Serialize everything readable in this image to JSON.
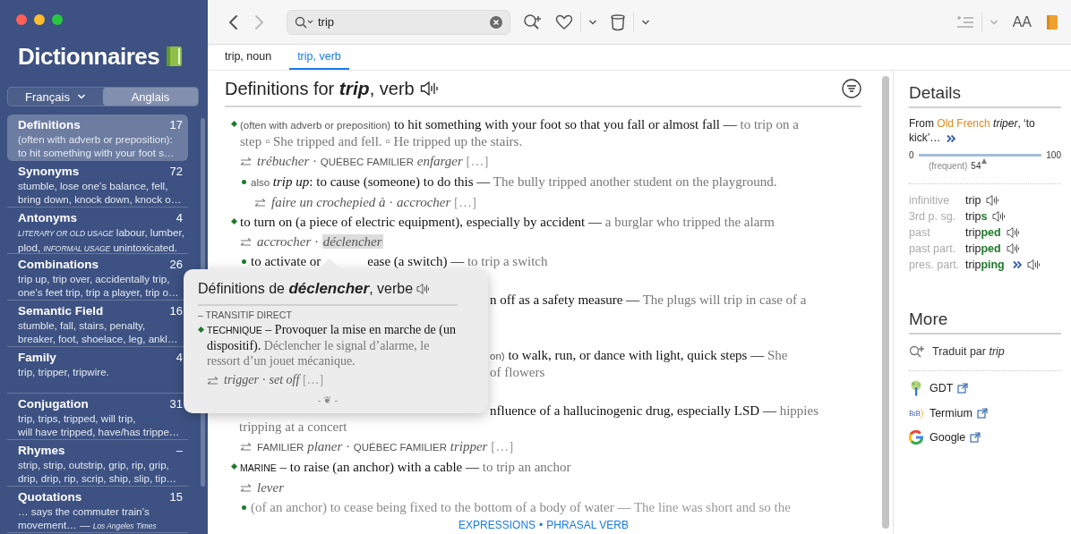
{
  "sidebar": {
    "title": "Dictionnaires",
    "languages": [
      {
        "label": "Français",
        "dropdown": true,
        "selected": false
      },
      {
        "label": "Anglais",
        "dropdown": false,
        "selected": true
      }
    ],
    "items": [
      {
        "title": "Definitions",
        "count": "17",
        "selected": true,
        "lines": [
          "(often with adverb or preposition):",
          "to hit something with your foot s…"
        ]
      },
      {
        "title": "Synonyms",
        "count": "72",
        "selected": false,
        "lines": [
          "stumble, lose one’s balance, fell,",
          "bring down, knock down, knock o…"
        ]
      },
      {
        "title": "Antonyms",
        "count": "4",
        "selected": false,
        "lines": [
          "*LITERARY OR OLD USAGE* labour, lumber,",
          "plod, *INFORMAL USAGE* unintoxicated."
        ]
      },
      {
        "title": "Combinations",
        "count": "26",
        "selected": false,
        "lines": [
          "trip up, trip over, accidentally trip,",
          "one’s feet trip, trip a player, trip o…"
        ]
      },
      {
        "title": "Semantic Field",
        "count": "16",
        "selected": false,
        "lines": [
          "stumble, fall, stairs, penalty,",
          "breaker, foot, shoelace, leg, ankl…"
        ]
      },
      {
        "title": "Family",
        "count": "4",
        "selected": false,
        "lines": [
          "trip, tripper, tripwire."
        ]
      },
      {
        "title": "Conjugation",
        "count": "31",
        "selected": false,
        "lines": [
          "trip, trips, tripped, will trip,",
          "will have tripped, have/has trippe…"
        ]
      },
      {
        "title": "Rhymes",
        "count": "–",
        "selected": false,
        "lines": [
          "strip, strip, outstrip, grip, rip, grip,",
          "drip, drip, rip, scrip, ship, slip, tip…"
        ]
      },
      {
        "title": "Quotations",
        "count": "15",
        "selected": false,
        "lines": [
          "… says the commuter train’s",
          "movement…  — *Los Angeles Times*"
        ]
      }
    ]
  },
  "toolbar": {
    "back_enabled": true,
    "forward_enabled": false,
    "search": {
      "value": "trip"
    },
    "font_size_label": "AA"
  },
  "tabs": [
    {
      "label": "trip, noun",
      "selected": false
    },
    {
      "label": "trip, verb",
      "selected": true
    }
  ],
  "entry": {
    "heading": {
      "prefix": "Definitions for",
      "word": "trip",
      "suffix": ", verb"
    },
    "lines": [
      {
        "kind": "sense",
        "parts": [
          {
            "kind": "label",
            "text": "(often with adverb or preposition)"
          },
          {
            "kind": "def",
            "text": "to hit something with your foot so that you fall or almost fall —"
          },
          {
            "kind": "example",
            "text": "to trip on a step ▫ She tripped and fell. ▫ He tripped up the stairs."
          }
        ]
      },
      {
        "kind": "translation",
        "parts": [
          {
            "kind": "word",
            "text": "trébucher"
          },
          {
            "kind": "sep",
            "text": "·"
          },
          {
            "kind": "label",
            "text": "QUÉBEC FAMILIER"
          },
          {
            "kind": "word",
            "text": "enfarger"
          },
          {
            "kind": "note",
            "text": "[…]"
          }
        ]
      },
      {
        "kind": "subsense",
        "parts": [
          {
            "kind": "label",
            "text": "also"
          },
          {
            "kind": "def",
            "text": "*trip up*: to cause (someone) to do this —"
          },
          {
            "kind": "example",
            "text": "The bully tripped another student on the playground."
          }
        ]
      },
      {
        "kind": "subtranslation",
        "parts": [
          {
            "kind": "word",
            "text": "faire un crochepied à"
          },
          {
            "kind": "sep",
            "text": "·"
          },
          {
            "kind": "word",
            "text": "accrocher"
          },
          {
            "kind": "note",
            "text": "[…]"
          }
        ]
      },
      {
        "kind": "sense",
        "parts": [
          {
            "kind": "def",
            "text": "to turn on (a piece of electric equipment), especially by accident —"
          },
          {
            "kind": "example",
            "text": "a burglar who tripped the alarm"
          }
        ]
      },
      {
        "kind": "translation",
        "parts": [
          {
            "kind": "word",
            "text": "accrocher",
            "highlighted": false
          },
          {
            "kind": "sep",
            "text": "·"
          },
          {
            "kind": "word",
            "text": "déclencher",
            "highlighted": true
          }
        ]
      },
      {
        "kind": "split",
        "parts": [
          {
            "kind": "def",
            "text": "to activate or"
          }
        ],
        "right_parts": [
          {
            "kind": "def",
            "text": "ease (a switch) —"
          },
          {
            "kind": "example",
            "text": "to trip a switch"
          }
        ]
      },
      {
        "kind": "partial",
        "parts": [
          {
            "kind": "def",
            "text": "n off as a safety measure —"
          },
          {
            "kind": "example",
            "text": "The plugs will trip in case of a"
          }
        ]
      },
      {
        "kind": "partial",
        "parts": [
          {
            "kind": "label",
            "text": "on)"
          },
          {
            "kind": "def",
            "text": "to walk, run, or dance with light, quick steps —"
          },
          {
            "kind": "example",
            "text": "She"
          }
        ]
      },
      {
        "kind": "partial_cont",
        "parts": [
          {
            "kind": "example",
            "text": "of flowers"
          }
        ]
      },
      {
        "kind": "partial",
        "parts": [
          {
            "kind": "def",
            "text": "nfluence of a hallucinogenic drug, especially LSD —"
          },
          {
            "kind": "example",
            "text": "hippies"
          }
        ]
      },
      {
        "kind": "continuation",
        "parts": [
          {
            "kind": "example",
            "text": "tripping at a concert"
          }
        ]
      },
      {
        "kind": "translation",
        "parts": [
          {
            "kind": "label",
            "text": "FAMILIER"
          },
          {
            "kind": "word",
            "text": "planer"
          },
          {
            "kind": "sep",
            "text": "·"
          },
          {
            "kind": "label",
            "text": "QUÉBEC FAMILIER"
          },
          {
            "kind": "word",
            "text": "tripper"
          },
          {
            "kind": "note",
            "text": "[…]"
          }
        ]
      },
      {
        "kind": "sense",
        "parts": [
          {
            "kind": "caps",
            "text": "MARINE"
          },
          {
            "kind": "def",
            "text": "– to raise (an anchor) with a cable —"
          },
          {
            "kind": "example",
            "text": "to trip an anchor"
          }
        ]
      },
      {
        "kind": "translation",
        "parts": [
          {
            "kind": "word",
            "text": "lever"
          }
        ]
      },
      {
        "kind": "faded",
        "parts": [
          {
            "kind": "def",
            "text": "(of an anchor) to cease being fixed to the bottom of a body of water —"
          },
          {
            "kind": "example",
            "text": "The line was short and so the"
          }
        ]
      }
    ],
    "footer_links": [
      "EXPRESSIONS",
      "PHRASAL VERB"
    ],
    "footer_sep": "•"
  },
  "popover": {
    "heading": {
      "prefix": "Définitions de",
      "word": "déclencher",
      "suffix": ", verbe"
    },
    "grammar": "– TRANSITIF DIRECT",
    "lines": [
      {
        "kind": "sense",
        "parts": [
          {
            "kind": "caps",
            "text": "TECHNIQUE"
          },
          {
            "kind": "def",
            "text": "– Provoquer la mise en marche de (un dispositif)."
          },
          {
            "kind": "example",
            "text": "Déclencher le signal d’alarme, le ressort d’un jouet mécanique."
          }
        ]
      },
      {
        "kind": "translation",
        "parts": [
          {
            "kind": "word",
            "text": "trigger"
          },
          {
            "kind": "sep",
            "text": "·"
          },
          {
            "kind": "word",
            "text": "set off"
          },
          {
            "kind": "note",
            "text": "[…]"
          }
        ]
      }
    ],
    "ornament": "- ❦ -"
  },
  "details": {
    "title": "Details",
    "etymology": [
      {
        "kind": "plain",
        "text": "From"
      },
      {
        "kind": "origin",
        "text": "Old French"
      },
      {
        "kind": "plain",
        "text": "*triper*, ‘to kick’…"
      }
    ],
    "frequency": {
      "min": "0",
      "max": "100",
      "level": 0.54,
      "label": "(frequent)",
      "value": "54"
    },
    "forms": [
      {
        "label": "infinitive",
        "stem": "trip",
        "has_more": false
      },
      {
        "label": "3rd p. sg.",
        "stem": "trip",
        "ending": "s",
        "has_more": false
      },
      {
        "label": "past",
        "stem": "trip",
        "ending": "ped",
        "has_more": false
      },
      {
        "label": "past part.",
        "stem": "trip",
        "ending": "ped",
        "has_more": false
      },
      {
        "label": "pres. part.",
        "stem": "trip",
        "ending": "ping",
        "has_more": true
      }
    ]
  },
  "more": {
    "title": "More",
    "translated_by": "Traduit par *trip*",
    "links": [
      {
        "kind": "tree",
        "label": "GDT"
      },
      {
        "kind": "btb",
        "label": "Termium",
        "logo_text": "BtB"
      },
      {
        "kind": "g",
        "label": "Google"
      }
    ]
  }
}
